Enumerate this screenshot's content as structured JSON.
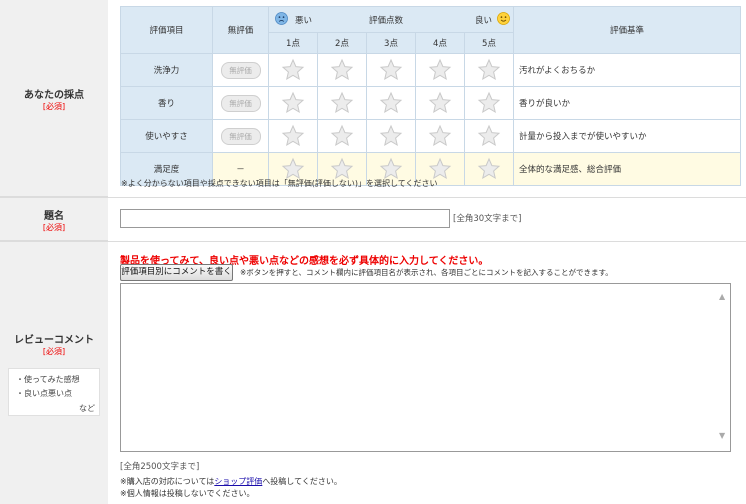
{
  "sections": {
    "score": {
      "label": "あなたの採点",
      "required": "[必須]"
    },
    "title": {
      "label": "題名",
      "required": "[必須]"
    },
    "review": {
      "label": "レビューコメント",
      "required": "[必須]"
    }
  },
  "rating_table": {
    "headers": {
      "item": "評価項目",
      "no_rating": "無評価",
      "bad": "悪い",
      "score_count": "評価点数",
      "good": "良い",
      "criteria": "評価基準"
    },
    "score_labels": [
      "1点",
      "2点",
      "3点",
      "4点",
      "5点"
    ],
    "rows": [
      {
        "item": "洗浄力",
        "no_rating": "無評価",
        "criteria": "汚れがよくおちるか"
      },
      {
        "item": "香り",
        "no_rating": "無評価",
        "criteria": "香りが良いか"
      },
      {
        "item": "使いやすさ",
        "no_rating": "無評価",
        "criteria": "計量から投入までが使いやすいか"
      },
      {
        "item": "満足度",
        "no_rating": "－",
        "criteria": "全体的な満足感、総合評価"
      }
    ],
    "note": "※よく分からない項目や採点できない項目は「無評価(評価しない)」を選択してください"
  },
  "title_field": {
    "value": "",
    "limit": "[全角30文字まで]"
  },
  "review": {
    "instruction": "製品を使ってみて、良い点や悪い点などの感想を必ず具体的に入力してください。",
    "button": "評価項目別にコメントを書く",
    "button_note": "※ボタンを押すと、コメント欄内に評価項目名が表示され、各項目ごとにコメントを記入することができます。",
    "value": "",
    "limit": "[全角2500文字まで]",
    "footnote1_prefix": "※購入店の対応については",
    "footnote1_link": "ショップ評価",
    "footnote1_suffix": "へ投稿してください。",
    "footnote2": "※個人情報は投稿しないでください。"
  },
  "tips": {
    "line1": "・使ってみた感想",
    "line2": "・良い点悪い点",
    "line3": "など"
  }
}
